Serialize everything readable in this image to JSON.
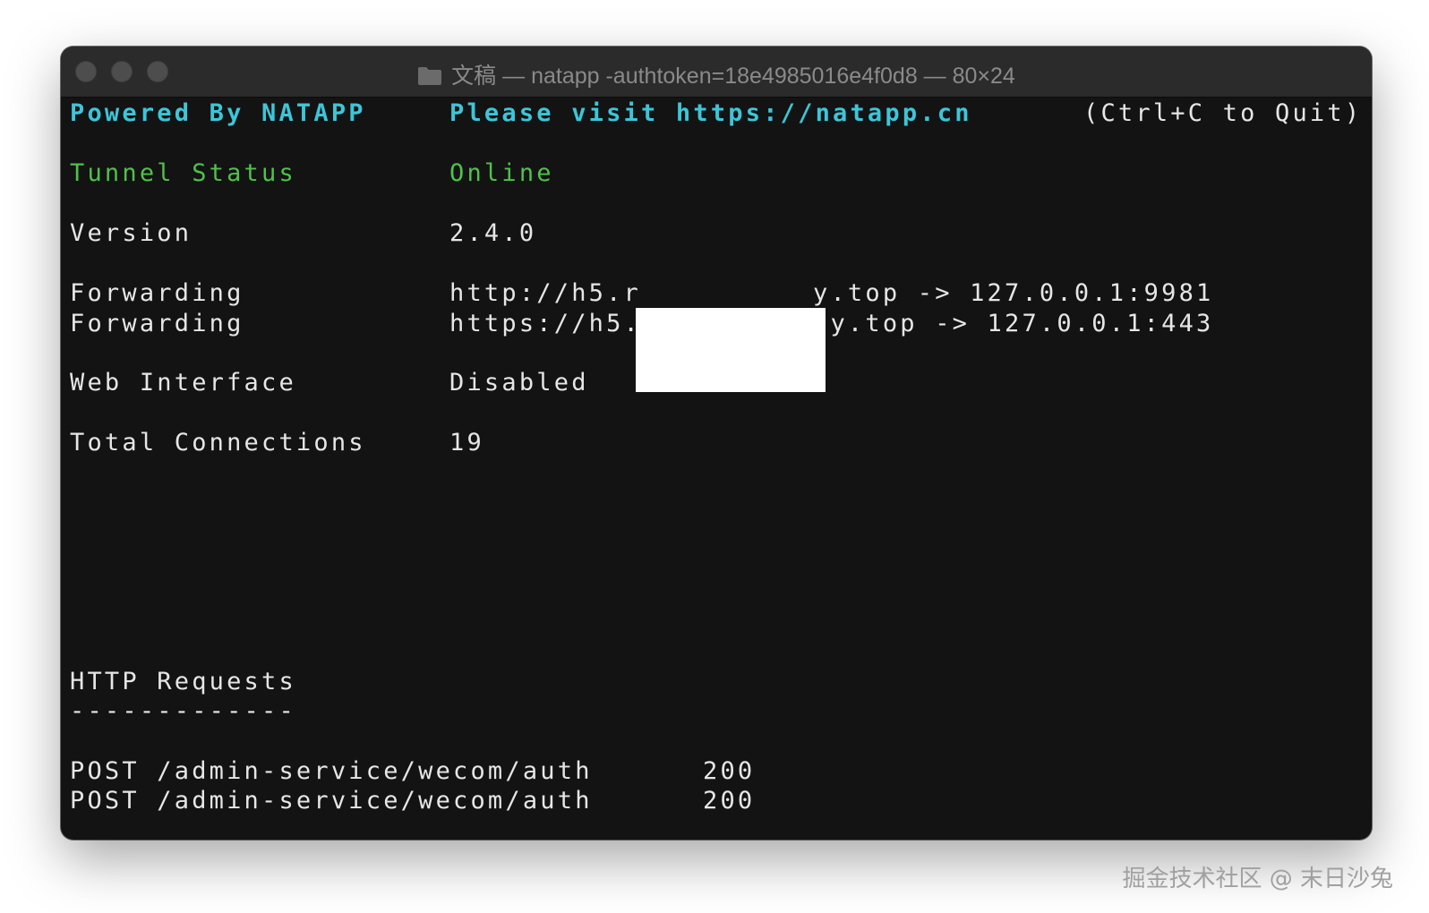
{
  "window": {
    "title": "文稿 — natapp -authtoken=18e4985016e4f0d8 — 80×24",
    "folder_icon": "folder-icon"
  },
  "header": {
    "powered_by": "Powered By NATAPP",
    "visit": "Please visit https://natapp.cn",
    "quit_hint": "(Ctrl+C to Quit)"
  },
  "status": {
    "tunnel_label": "Tunnel Status",
    "tunnel_value": "Online",
    "version_label": "Version",
    "version_value": "2.4.0",
    "forwarding": [
      {
        "label": "Forwarding",
        "left": "http://h5.r",
        "right": "y.top -> 127.0.0.1:9981"
      },
      {
        "label": "Forwarding",
        "left": "https://h5.",
        "right": "ay.top -> 127.0.0.1:443"
      }
    ],
    "web_label": "Web Interface",
    "web_value": "Disabled",
    "connections_label": "Total Connections",
    "connections_value": "19"
  },
  "requests": {
    "title": "HTTP Requests",
    "divider": "-------------",
    "rows": [
      {
        "method_path": "POST /admin-service/wecom/auth",
        "status": "200"
      },
      {
        "method_path": "POST /admin-service/wecom/auth",
        "status": "200"
      }
    ]
  },
  "watermark": "掘金技术社区 @ 末日沙兔",
  "colors": {
    "accent_cyan": "#3cc6d8",
    "status_green": "#4fc24a",
    "terminal_bg": "#131313",
    "text": "#e6e6e6"
  }
}
